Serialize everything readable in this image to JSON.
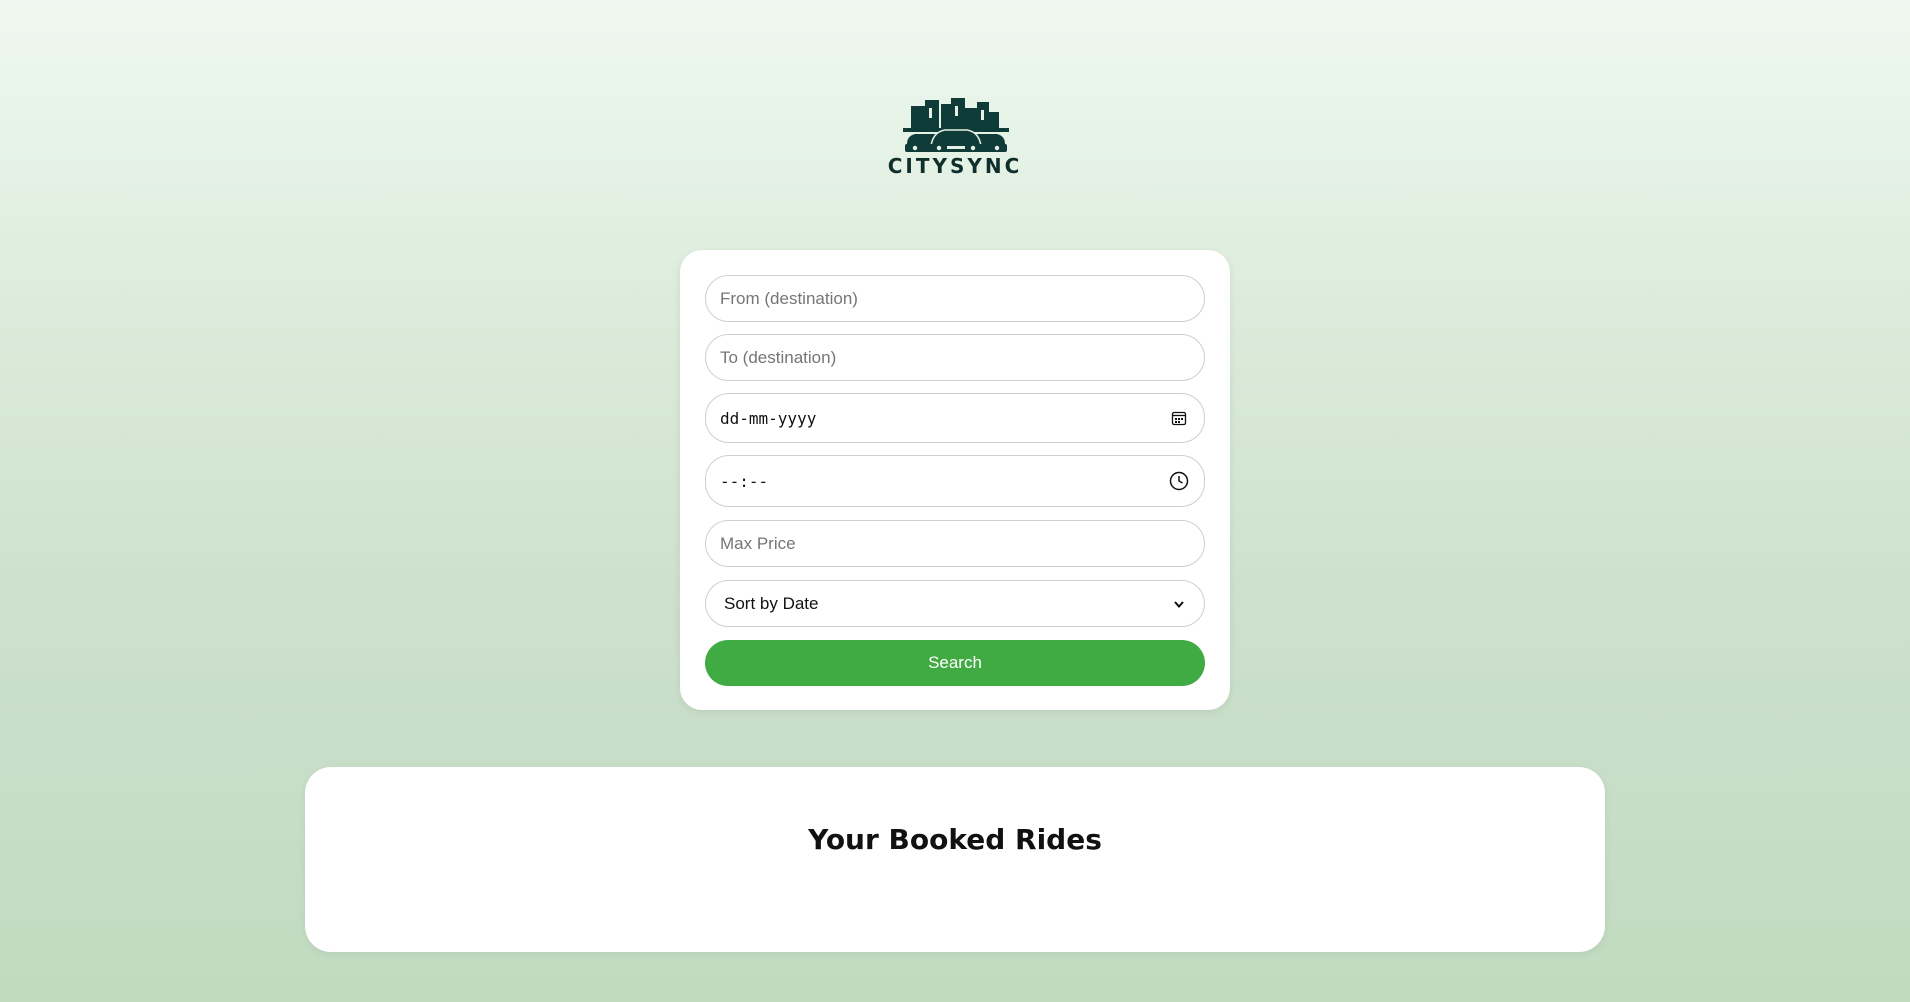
{
  "brand": {
    "name": "CITYSYNC",
    "logo_icon": "city-cars-logo-icon",
    "color": "#0f3b38"
  },
  "search_form": {
    "from_placeholder": "From (destination)",
    "to_placeholder": "To (destination)",
    "date_placeholder": "dd-mm-yyyy",
    "date_icon": "calendar-icon",
    "time_placeholder": "--:--",
    "time_icon": "clock-icon",
    "max_price_placeholder": "Max Price",
    "sort": {
      "selected": "Sort by Date",
      "icon": "chevron-down-icon"
    },
    "search_label": "Search",
    "accent_color": "#41ab43"
  },
  "booked_rides": {
    "title": "Your Booked Rides"
  }
}
